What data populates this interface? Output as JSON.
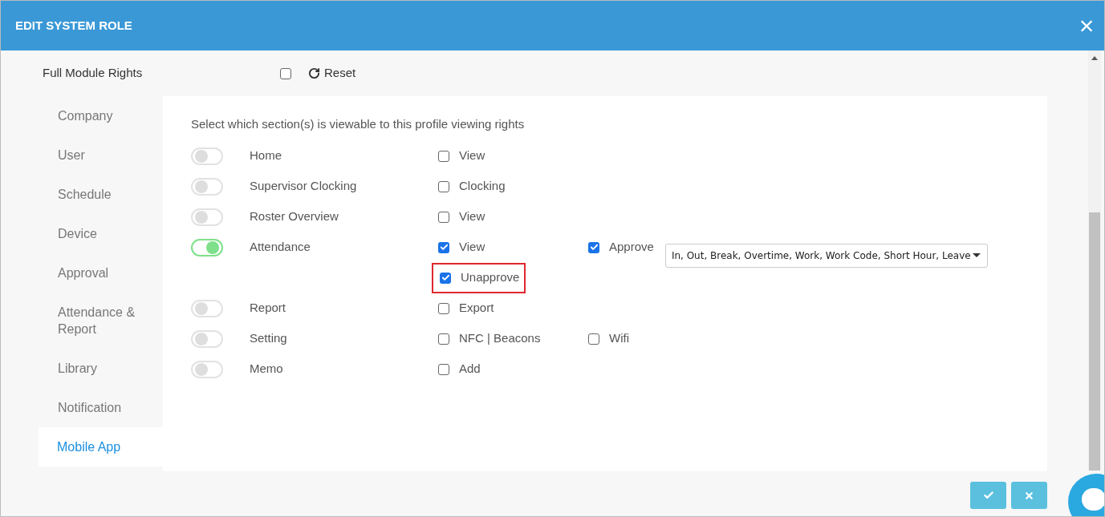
{
  "dialog": {
    "title": "EDIT SYSTEM ROLE",
    "close": "×"
  },
  "full_module_rights": {
    "label": "Full Module Rights",
    "checked": false,
    "reset": "Reset"
  },
  "sidebar": {
    "items": [
      {
        "label": "Company",
        "selected": false
      },
      {
        "label": "User",
        "selected": false
      },
      {
        "label": "Schedule",
        "selected": false
      },
      {
        "label": "Device",
        "selected": false
      },
      {
        "label": "Approval",
        "selected": false
      },
      {
        "label": "Attendance & Report",
        "selected": false
      },
      {
        "label": "Library",
        "selected": false
      },
      {
        "label": "Notification",
        "selected": false
      },
      {
        "label": "Mobile App",
        "selected": true
      }
    ]
  },
  "panel": {
    "intro": "Select which section(s) is viewable to this profile viewing rights",
    "modules": [
      {
        "name": "Home",
        "on": false,
        "options": [
          {
            "label": "View",
            "checked": false
          }
        ]
      },
      {
        "name": "Supervisor Clocking",
        "on": false,
        "options": [
          {
            "label": "Clocking",
            "checked": false
          }
        ]
      },
      {
        "name": "Roster Overview",
        "on": false,
        "options": [
          {
            "label": "View",
            "checked": false
          }
        ]
      },
      {
        "name": "Attendance",
        "on": true,
        "options": [
          {
            "label": "View",
            "checked": true
          },
          {
            "label": "Approve",
            "checked": true,
            "select": "In, Out, Break, Overtime, Work, Work Code, Short Hour, Leave"
          }
        ],
        "sub_options": [
          {
            "label": "Unapprove",
            "checked": true,
            "highlighted": true
          }
        ]
      },
      {
        "name": "Report",
        "on": false,
        "options": [
          {
            "label": "Export",
            "checked": false
          }
        ]
      },
      {
        "name": "Setting",
        "on": false,
        "options": [
          {
            "label": "NFC | Beacons",
            "checked": false
          },
          {
            "label": "Wifi",
            "checked": false
          }
        ]
      },
      {
        "name": "Memo",
        "on": false,
        "options": [
          {
            "label": "Add",
            "checked": false
          }
        ]
      }
    ]
  },
  "footer": {
    "buttons": [
      {
        "kind": "confirm"
      },
      {
        "kind": "cancel"
      }
    ]
  }
}
